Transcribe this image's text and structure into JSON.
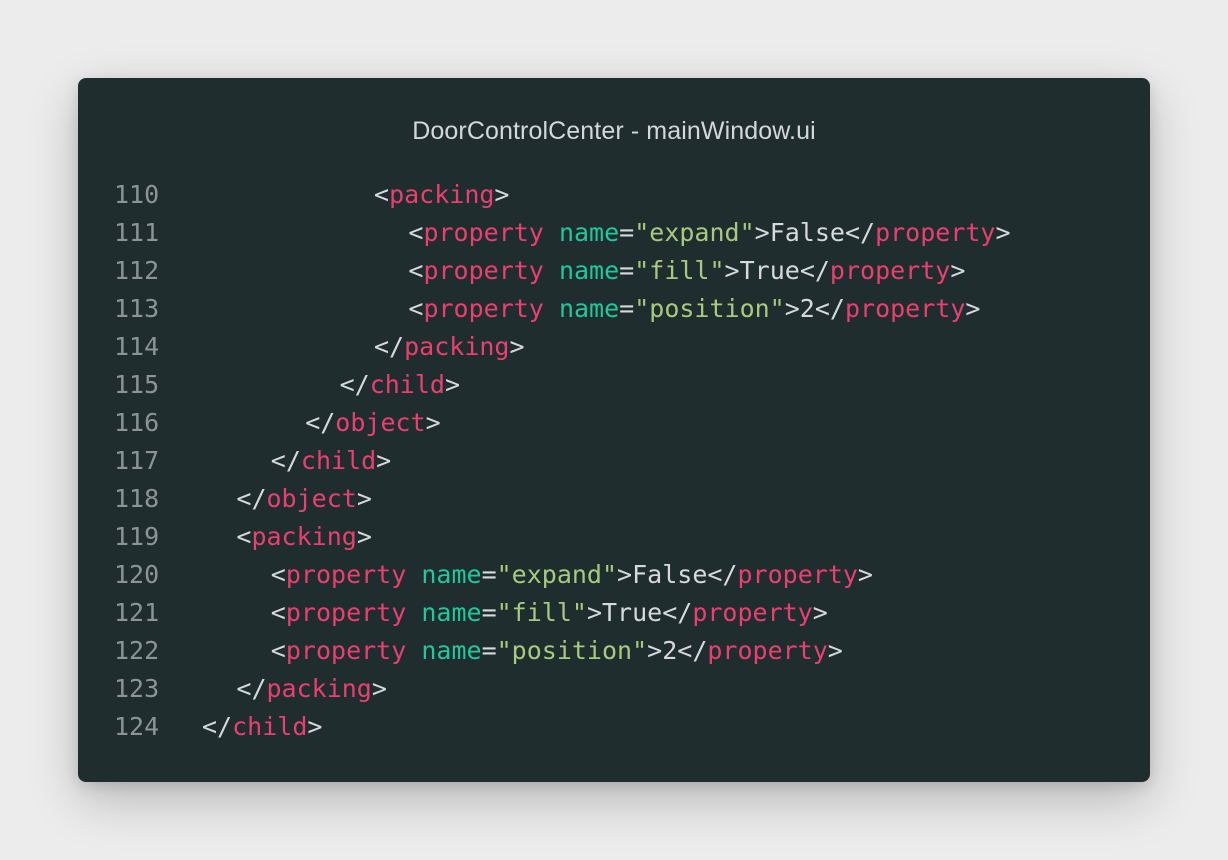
{
  "window": {
    "title": "DoorControlCenter - mainWindow.ui"
  },
  "editor": {
    "lines": [
      {
        "num": "110",
        "indent": "      ",
        "parts": [
          {
            "c": "p",
            "t": "<"
          },
          {
            "c": "t",
            "t": "packing"
          },
          {
            "c": "p",
            "t": ">"
          }
        ]
      },
      {
        "num": "111",
        "indent": "        ",
        "parts": [
          {
            "c": "p",
            "t": "<"
          },
          {
            "c": "t",
            "t": "property"
          },
          {
            "c": "p",
            "t": " "
          },
          {
            "c": "a",
            "t": "name"
          },
          {
            "c": "p",
            "t": "="
          },
          {
            "c": "s",
            "t": "\"expand\""
          },
          {
            "c": "p",
            "t": ">"
          },
          {
            "c": "x",
            "t": "False"
          },
          {
            "c": "p",
            "t": "</"
          },
          {
            "c": "t",
            "t": "property"
          },
          {
            "c": "p",
            "t": ">"
          }
        ]
      },
      {
        "num": "112",
        "indent": "        ",
        "parts": [
          {
            "c": "p",
            "t": "<"
          },
          {
            "c": "t",
            "t": "property"
          },
          {
            "c": "p",
            "t": " "
          },
          {
            "c": "a",
            "t": "name"
          },
          {
            "c": "p",
            "t": "="
          },
          {
            "c": "s",
            "t": "\"fill\""
          },
          {
            "c": "p",
            "t": ">"
          },
          {
            "c": "x",
            "t": "True"
          },
          {
            "c": "p",
            "t": "</"
          },
          {
            "c": "t",
            "t": "property"
          },
          {
            "c": "p",
            "t": ">"
          }
        ]
      },
      {
        "num": "113",
        "indent": "        ",
        "parts": [
          {
            "c": "p",
            "t": "<"
          },
          {
            "c": "t",
            "t": "property"
          },
          {
            "c": "p",
            "t": " "
          },
          {
            "c": "a",
            "t": "name"
          },
          {
            "c": "p",
            "t": "="
          },
          {
            "c": "s",
            "t": "\"position\""
          },
          {
            "c": "p",
            "t": ">"
          },
          {
            "c": "x",
            "t": "2"
          },
          {
            "c": "p",
            "t": "</"
          },
          {
            "c": "t",
            "t": "property"
          },
          {
            "c": "p",
            "t": ">"
          }
        ]
      },
      {
        "num": "114",
        "indent": "      ",
        "parts": [
          {
            "c": "p",
            "t": "</"
          },
          {
            "c": "t",
            "t": "packing"
          },
          {
            "c": "p",
            "t": ">"
          }
        ]
      },
      {
        "num": "115",
        "indent": "    ",
        "parts": [
          {
            "c": "p",
            "t": "</"
          },
          {
            "c": "t",
            "t": "child"
          },
          {
            "c": "p",
            "t": ">"
          }
        ]
      },
      {
        "num": "116",
        "indent": "  ",
        "parts": [
          {
            "c": "p",
            "t": "</"
          },
          {
            "c": "t",
            "t": "object"
          },
          {
            "c": "p",
            "t": ">"
          }
        ]
      },
      {
        "num": "117",
        "indent": "",
        "parts": [
          {
            "c": "p",
            "t": "</"
          },
          {
            "c": "t",
            "t": "child"
          },
          {
            "c": "p",
            "t": ">"
          }
        ]
      },
      {
        "num": "118",
        "indent": "",
        "parts": [
          {
            "c": "p",
            "t": "</"
          },
          {
            "c": "t",
            "t": "object"
          },
          {
            "c": "p",
            "t": ">"
          }
        ]
      },
      {
        "num": "119",
        "indent": "",
        "parts": [
          {
            "c": "p",
            "t": "<"
          },
          {
            "c": "t",
            "t": "packing"
          },
          {
            "c": "p",
            "t": ">"
          }
        ]
      },
      {
        "num": "120",
        "indent": "",
        "parts": [
          {
            "c": "p",
            "t": "<"
          },
          {
            "c": "t",
            "t": "property"
          },
          {
            "c": "p",
            "t": " "
          },
          {
            "c": "a",
            "t": "name"
          },
          {
            "c": "p",
            "t": "="
          },
          {
            "c": "s",
            "t": "\"expand\""
          },
          {
            "c": "p",
            "t": ">"
          },
          {
            "c": "x",
            "t": "False"
          },
          {
            "c": "p",
            "t": "</"
          },
          {
            "c": "t",
            "t": "property"
          },
          {
            "c": "p",
            "t": ">"
          }
        ]
      },
      {
        "num": "121",
        "indent": "",
        "parts": [
          {
            "c": "p",
            "t": "<"
          },
          {
            "c": "t",
            "t": "property"
          },
          {
            "c": "p",
            "t": " "
          },
          {
            "c": "a",
            "t": "name"
          },
          {
            "c": "p",
            "t": "="
          },
          {
            "c": "s",
            "t": "\"fill\""
          },
          {
            "c": "p",
            "t": ">"
          },
          {
            "c": "x",
            "t": "True"
          },
          {
            "c": "p",
            "t": "</"
          },
          {
            "c": "t",
            "t": "property"
          },
          {
            "c": "p",
            "t": ">"
          }
        ]
      },
      {
        "num": "122",
        "indent": "",
        "parts": [
          {
            "c": "p",
            "t": "<"
          },
          {
            "c": "t",
            "t": "property"
          },
          {
            "c": "p",
            "t": " "
          },
          {
            "c": "a",
            "t": "name"
          },
          {
            "c": "p",
            "t": "="
          },
          {
            "c": "s",
            "t": "\"position\""
          },
          {
            "c": "p",
            "t": ">"
          },
          {
            "c": "x",
            "t": "2"
          },
          {
            "c": "p",
            "t": "</"
          },
          {
            "c": "t",
            "t": "property"
          },
          {
            "c": "p",
            "t": ">"
          }
        ]
      },
      {
        "num": "123",
        "indent": "",
        "parts": [
          {
            "c": "p",
            "t": "</"
          },
          {
            "c": "t",
            "t": "packing"
          },
          {
            "c": "p",
            "t": ">"
          }
        ]
      },
      {
        "num": "124",
        "indent": "",
        "parts": [
          {
            "c": "p",
            "t": "</"
          },
          {
            "c": "t",
            "t": "child"
          },
          {
            "c": "p",
            "t": ">"
          }
        ]
      }
    ]
  },
  "colors": {
    "background": "#1f2d2f",
    "tag": "#ea3f6f",
    "attribute": "#22c79a",
    "string": "#a9c97e",
    "text": "#d6dadb",
    "line_number": "#8b9596"
  }
}
